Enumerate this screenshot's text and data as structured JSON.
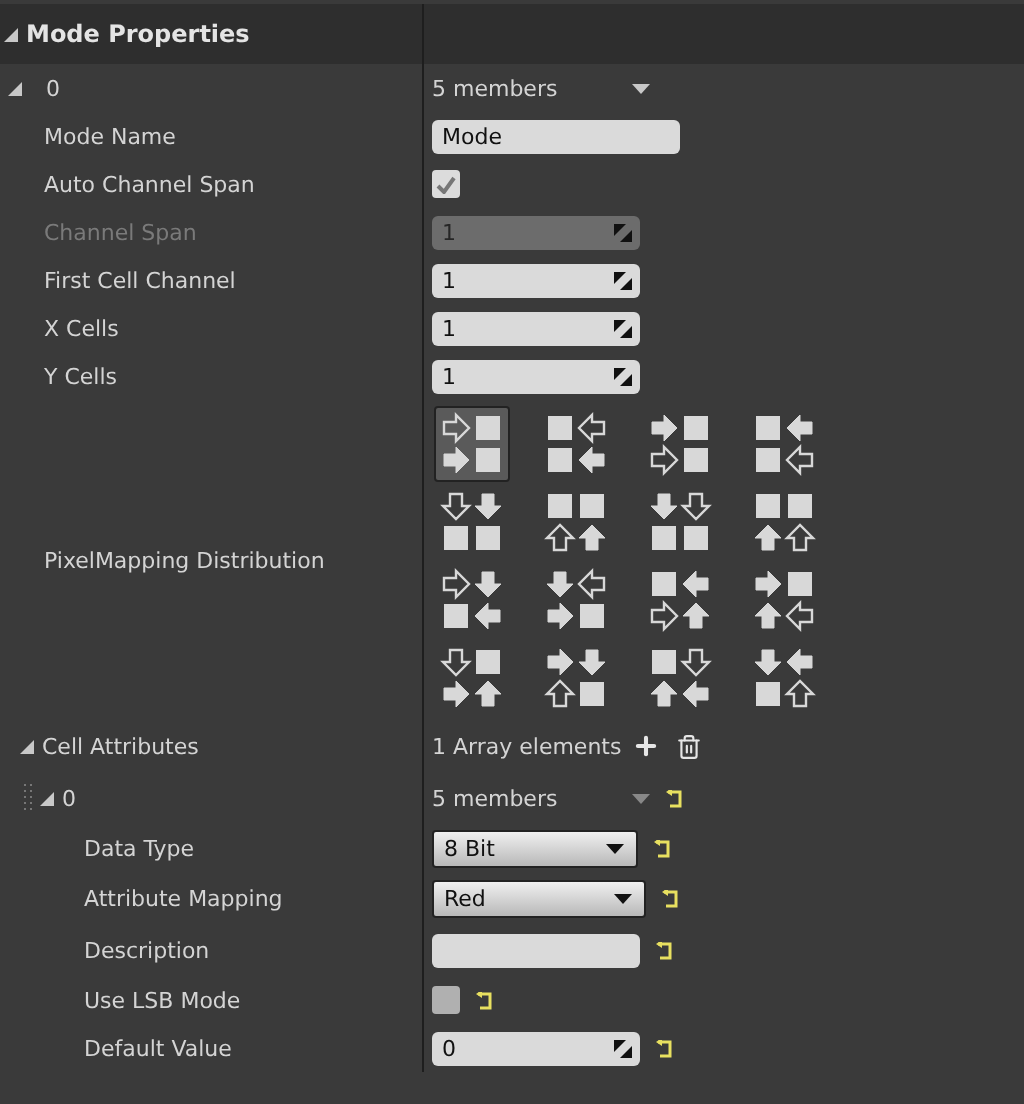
{
  "panel": {
    "title": "Mode Properties",
    "expanded": true
  },
  "mode_entry": {
    "index": "0",
    "summary": "5 members",
    "expanded": true,
    "properties": [
      {
        "kind": "text",
        "label": "Mode Name",
        "value": "Mode",
        "disabled": false
      },
      {
        "kind": "checkbox",
        "label": "Auto Channel Span",
        "checked": true,
        "disabled": false
      },
      {
        "kind": "number",
        "label": "Channel Span",
        "value": "1",
        "disabled": true
      },
      {
        "kind": "number",
        "label": "First Cell Channel",
        "value": "1",
        "disabled": false
      },
      {
        "kind": "number",
        "label": "X Cells",
        "value": "1",
        "disabled": false
      },
      {
        "kind": "number",
        "label": "Y Cells",
        "value": "1",
        "disabled": false
      }
    ],
    "distribution": {
      "label": "PixelMapping Distribution",
      "options": [
        {
          "selected": true
        },
        {
          "selected": false
        },
        {
          "selected": false
        },
        {
          "selected": false
        },
        {
          "selected": false
        },
        {
          "selected": false
        },
        {
          "selected": false
        },
        {
          "selected": false
        },
        {
          "selected": false
        },
        {
          "selected": false
        },
        {
          "selected": false
        },
        {
          "selected": false
        },
        {
          "selected": false
        },
        {
          "selected": false
        },
        {
          "selected": false
        },
        {
          "selected": false
        }
      ]
    },
    "cell_attributes": {
      "label": "Cell Attributes",
      "expanded": true,
      "summary": "1 Array elements",
      "entries": [
        {
          "index": "0",
          "summary": "5 members",
          "expanded": true,
          "resettable": true,
          "properties": [
            {
              "kind": "dropdown",
              "label": "Data Type",
              "value": "8 Bit",
              "resettable": true
            },
            {
              "kind": "dropdown",
              "label": "Attribute Mapping",
              "value": "Red",
              "resettable": true
            },
            {
              "kind": "text",
              "label": "Description",
              "resettable": true
            },
            {
              "kind": "checkbox",
              "label": "Use LSB Mode",
              "checked": false,
              "resettable": true
            },
            {
              "kind": "number",
              "label": "Default Value",
              "value": "0",
              "resettable": true
            }
          ]
        }
      ]
    }
  }
}
